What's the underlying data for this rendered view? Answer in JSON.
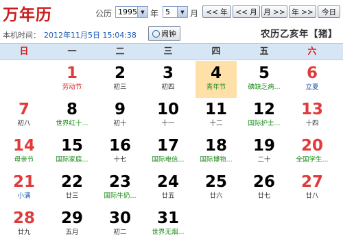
{
  "app": {
    "title": "万年历"
  },
  "controls": {
    "calendar_type_label": "公历",
    "year_value": "1995",
    "year_label": "年",
    "month_value": "5",
    "month_label": "月",
    "prev_year": "<< 年",
    "prev_month": "<< 月",
    "next_month": "月 >>",
    "next_year": "年 >>",
    "today": "今日"
  },
  "status": {
    "local_time_label": "本机时间：",
    "local_time_value": "2012年11月5日 15:04:38",
    "alarm_label": "闹钟",
    "lunar_year": "农历乙亥年【猪】"
  },
  "weekdays": [
    "日",
    "一",
    "二",
    "三",
    "四",
    "五",
    "六"
  ],
  "colors": {
    "red": "#e23a3a",
    "green": "#1a8a1a",
    "blue": "#1e57b0",
    "today_bg": "#ffe0a8"
  },
  "days": [
    {
      "day": "1",
      "sub": "劳动节",
      "sub_color": "red"
    },
    {
      "day": "2",
      "sub": "初三"
    },
    {
      "day": "3",
      "sub": "初四"
    },
    {
      "day": "4",
      "sub": "青年节",
      "sub_color": "green",
      "today": true
    },
    {
      "day": "5",
      "sub": "碘缺乏病...",
      "sub_color": "green"
    },
    {
      "day": "6",
      "sub": "立夏",
      "sub_color": "blue"
    },
    {
      "day": "7",
      "sub": "初八"
    },
    {
      "day": "8",
      "sub": "世界红十...",
      "sub_color": "green"
    },
    {
      "day": "9",
      "sub": "初十"
    },
    {
      "day": "10",
      "sub": "十一"
    },
    {
      "day": "11",
      "sub": "十二"
    },
    {
      "day": "12",
      "sub": "国际护士...",
      "sub_color": "green"
    },
    {
      "day": "13",
      "sub": "十四"
    },
    {
      "day": "14",
      "sub": "母亲节",
      "sub_color": "green"
    },
    {
      "day": "15",
      "sub": "国际家庭...",
      "sub_color": "green"
    },
    {
      "day": "16",
      "sub": "十七"
    },
    {
      "day": "17",
      "sub": "国际电信...",
      "sub_color": "green"
    },
    {
      "day": "18",
      "sub": "国际博物...",
      "sub_color": "green"
    },
    {
      "day": "19",
      "sub": "二十"
    },
    {
      "day": "20",
      "sub": "全国学生...",
      "sub_color": "green"
    },
    {
      "day": "21",
      "sub": "小满",
      "sub_color": "blue"
    },
    {
      "day": "22",
      "sub": "廿三"
    },
    {
      "day": "23",
      "sub": "国际牛奶...",
      "sub_color": "green"
    },
    {
      "day": "24",
      "sub": "廿五"
    },
    {
      "day": "25",
      "sub": "廿六"
    },
    {
      "day": "26",
      "sub": "廿七"
    },
    {
      "day": "27",
      "sub": "廿八"
    },
    {
      "day": "28",
      "sub": "廿九"
    },
    {
      "day": "29",
      "sub": "五月"
    },
    {
      "day": "30",
      "sub": "初二"
    },
    {
      "day": "31",
      "sub": "世界无烟...",
      "sub_color": "green"
    }
  ],
  "first_weekday_index": 1
}
